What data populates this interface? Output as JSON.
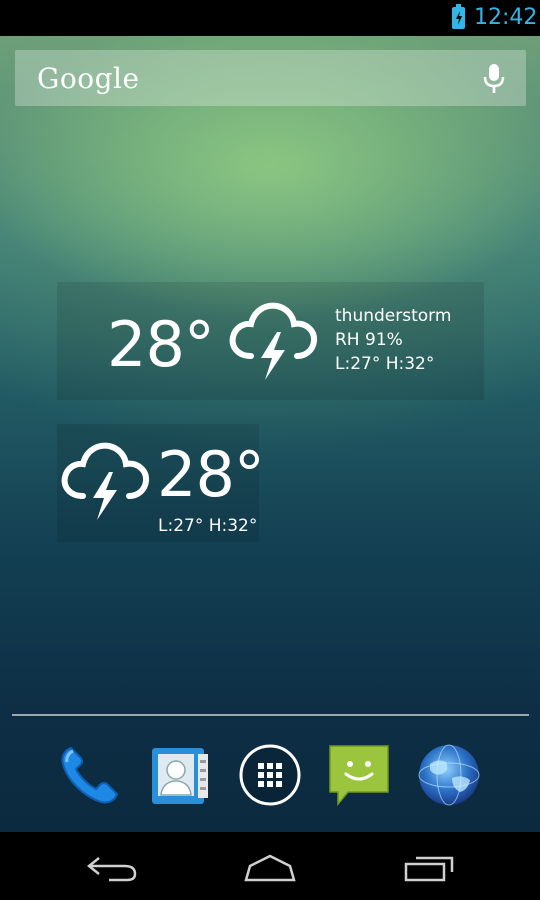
{
  "status_bar": {
    "time": "12:42",
    "battery_icon": "battery-charging-icon"
  },
  "search": {
    "logo": "Google",
    "mic_icon": "microphone-icon"
  },
  "weather_widget_large": {
    "temperature": "28°",
    "condition": "thunderstorm",
    "humidity": "RH 91%",
    "range": "L:27° H:32°",
    "icon": "thunderstorm-icon"
  },
  "weather_widget_small": {
    "temperature": "28°",
    "range": "L:27° H:32°",
    "icon": "thunderstorm-icon"
  },
  "dock": {
    "items": [
      {
        "name": "Phone",
        "icon": "phone-icon"
      },
      {
        "name": "People",
        "icon": "contacts-icon"
      },
      {
        "name": "Apps",
        "icon": "all-apps-icon"
      },
      {
        "name": "Messaging",
        "icon": "messaging-icon"
      },
      {
        "name": "Browser",
        "icon": "browser-globe-icon"
      }
    ]
  },
  "navbar": {
    "back_icon": "back-icon",
    "home_icon": "home-icon",
    "recent_icon": "recent-apps-icon"
  },
  "colors": {
    "accent": "#33b5e5",
    "message_green": "#a4c639"
  }
}
